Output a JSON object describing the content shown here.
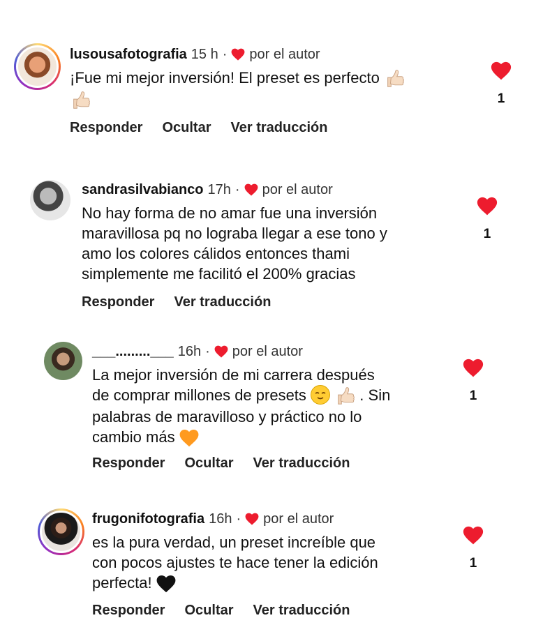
{
  "colors": {
    "heart": "#ed1c2e",
    "text": "#111111",
    "muted": "#333333"
  },
  "comments": [
    {
      "user": "lusousafotografia",
      "time": "15 h",
      "dot": "·",
      "author_label": "por el autor",
      "text": "¡Fue mi mejor inversión! El preset es perfecto",
      "emojis": [
        "thumbs-up",
        "thumbs-up"
      ],
      "likes": "1",
      "actions": [
        "Responder",
        "Ocultar",
        "Ver traducción"
      ]
    },
    {
      "user": "sandrasilvabianco",
      "time": "17h",
      "dot": "·",
      "author_label": "por el autor",
      "text_lines": [
        "No hay forma de no amar fue una inversión",
        "maravillosa pq no lograba llegar a ese tono y",
        "amo los colores cálidos entonces thami",
        "simplemente me facilitó el 200% gracias"
      ],
      "likes": "1",
      "actions": [
        "Responder",
        "Ver traducción"
      ]
    },
    {
      "user": "___.........___",
      "time": "16h",
      "dot": "·",
      "author_label": "por el autor",
      "text_lines": [
        "La mejor inversión de mi carrera después",
        "de comprar millones de presets",
        ". Sin",
        "palabras de maravilloso y práctico no lo",
        "cambio más"
      ],
      "emojis": [
        "relieved-face",
        "thumbs-up",
        "orange-heart"
      ],
      "likes": "1",
      "actions": [
        "Responder",
        "Ocultar",
        "Ver traducción"
      ]
    },
    {
      "user": "frugonifotografia",
      "time": "16h",
      "dot": "·",
      "author_label": "por el autor",
      "text_lines": [
        "es la pura verdad, un preset increíble que",
        "con pocos ajustes te hace tener la edición",
        "perfecta!"
      ],
      "emojis": [
        "black-heart"
      ],
      "likes": "1",
      "actions": [
        "Responder",
        "Ocultar",
        "Ver traducción"
      ]
    }
  ]
}
